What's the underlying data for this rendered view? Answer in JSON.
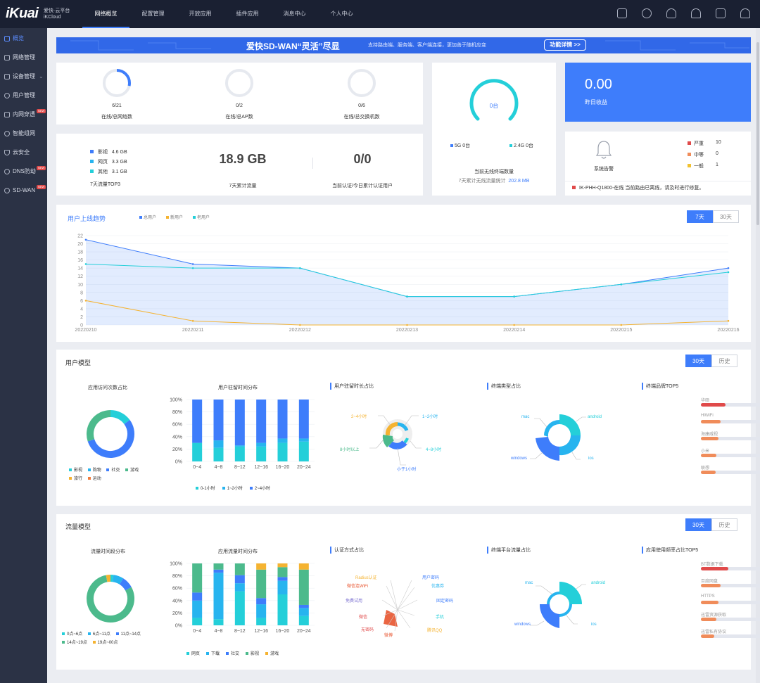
{
  "top": {
    "logo": "iKuai",
    "logo_sub1": "爱快·云平台",
    "logo_sub2": "iKCloud",
    "nav": [
      "网络概览",
      "配置管理",
      "开放应用",
      "插件应用",
      "消息中心",
      "个人中心"
    ]
  },
  "sidebar": {
    "items": [
      {
        "label": "概览",
        "badge": ""
      },
      {
        "label": "网络管理",
        "badge": ""
      },
      {
        "label": "设备管理",
        "badge": ""
      },
      {
        "label": "用户管理",
        "badge": ""
      },
      {
        "label": "内网穿透",
        "badge": "NEW"
      },
      {
        "label": "智能组网",
        "badge": ""
      },
      {
        "label": "云安全",
        "badge": ""
      },
      {
        "label": "DNS防劫",
        "badge": "NEW"
      },
      {
        "label": "SD-WAN",
        "badge": "NEW"
      }
    ]
  },
  "banner": {
    "title": "爱快SD-WAN“灵活”尽显",
    "desc": "支持路由端、服务端、客户端连接，更加善于随机应变",
    "button": "功能详情 >>"
  },
  "stats": {
    "rings": [
      {
        "value": "6/21",
        "label": "在线/总网络数",
        "fraction": 0.2857
      },
      {
        "value": "0/2",
        "label": "在线/总AP数",
        "fraction": 0
      },
      {
        "value": "0/6",
        "label": "在线/总交换机数",
        "fraction": 0
      }
    ],
    "traffic_top3": [
      {
        "name": "影视",
        "value": "4.6 GB",
        "color": "#3e7dfb"
      },
      {
        "name": "网页",
        "value": "3.3 GB",
        "color": "#27b4ef"
      },
      {
        "name": "其他",
        "value": "3.1 GB",
        "color": "#24cfd9"
      }
    ],
    "traffic_top3_label": "7天流量TOP3",
    "total_traffic": "18.9 GB",
    "total_traffic_label": "7天累计流量",
    "auth": "0/0",
    "auth_label": "当前认证/今日累计认证用户"
  },
  "wireless": {
    "center": "0台",
    "g5": "5G  0台",
    "g24": "2.4G  0台",
    "label": "当前无线终端数量",
    "sub_label": "7天累计无线流量统计",
    "sub_value": "202.8 MB"
  },
  "income": {
    "value": "0.00",
    "label": "昨日收益"
  },
  "alarm": {
    "label": "系统告警",
    "levels": [
      {
        "name": "严重",
        "count": "10",
        "color": "#e04a4a"
      },
      {
        "name": "中等",
        "count": "0",
        "color": "#f08c5a"
      },
      {
        "name": "一般",
        "count": "1",
        "color": "#f2c230"
      }
    ],
    "message": "IK-PHH-Q1800-在线  当前路由已离线，请及时进行修复。"
  },
  "trend": {
    "title": "用户上线趋势",
    "legend": [
      {
        "name": "总用户",
        "color": "#3e7dfb"
      },
      {
        "name": "新用户",
        "color": "#f5b331"
      },
      {
        "name": "老用户",
        "color": "#24cfd9"
      }
    ],
    "tabs": [
      "7天",
      "30天"
    ]
  },
  "chart_data": [
    {
      "type": "area",
      "title": "用户上线趋势",
      "x": [
        "20220210",
        "20220211",
        "20220212",
        "20220213",
        "20220214",
        "20220215",
        "20220216"
      ],
      "ylim": [
        0,
        22
      ],
      "yticks": [
        0,
        2,
        4,
        6,
        8,
        10,
        12,
        14,
        16,
        18,
        20,
        22
      ],
      "series": [
        {
          "name": "总用户",
          "values": [
            21,
            15,
            14,
            7,
            7,
            10,
            14
          ],
          "color": "#3e7dfb"
        },
        {
          "name": "新用户",
          "values": [
            6,
            1,
            0,
            0,
            0,
            0,
            1
          ],
          "color": "#f5b331"
        },
        {
          "name": "老用户",
          "values": [
            15,
            14,
            14,
            7,
            7,
            10,
            13
          ],
          "color": "#24cfd9"
        }
      ]
    },
    {
      "type": "bar",
      "title": "用户驻留时间分布",
      "categories": [
        "0~4",
        "4~8",
        "8~12",
        "12~16",
        "16~20",
        "20~24"
      ],
      "ylim": [
        0,
        100
      ],
      "yticks": [
        "0%",
        "20%",
        "40%",
        "60%",
        "80%",
        "100%"
      ],
      "series": [
        {
          "name": "0-1小时",
          "values": [
            30,
            22,
            24,
            24,
            30,
            32
          ],
          "color": "#24cfd9"
        },
        {
          "name": "1~2小时",
          "values": [
            0,
            12,
            2,
            6,
            7,
            5
          ],
          "color": "#27b4ef"
        },
        {
          "name": "2~4小时",
          "values": [
            70,
            66,
            74,
            70,
            63,
            63
          ],
          "color": "#3e7dfb"
        }
      ]
    },
    {
      "type": "bar",
      "title": "应用流量时间分布",
      "categories": [
        "0~4",
        "4~8",
        "8~12",
        "12~16",
        "16~20",
        "20~24"
      ],
      "ylim": [
        0,
        100
      ],
      "yticks": [
        "0%",
        "20%",
        "40%",
        "60%",
        "80%",
        "100%"
      ],
      "series": [
        {
          "name": "网页",
          "values": [
            12,
            10,
            55,
            12,
            50,
            15
          ],
          "color": "#24cfd9"
        },
        {
          "name": "下载",
          "values": [
            28,
            75,
            13,
            22,
            22,
            13
          ],
          "color": "#27b4ef"
        },
        {
          "name": "社交",
          "values": [
            13,
            5,
            13,
            10,
            6,
            5
          ],
          "color": "#3e7dfb"
        },
        {
          "name": "影视",
          "values": [
            47,
            10,
            19,
            46,
            16,
            57
          ],
          "color": "#4cba8c"
        },
        {
          "name": "游戏",
          "values": [
            0,
            0,
            0,
            10,
            6,
            10
          ],
          "color": "#f5b331"
        }
      ]
    },
    {
      "type": "pie",
      "title": "应用访问次数占比",
      "categories": [
        "影视",
        "购物",
        "社交",
        "游戏",
        "旅行",
        "运动"
      ],
      "values": [
        15,
        0,
        55,
        30,
        0,
        0
      ],
      "colors": [
        "#24cfd9",
        "#27b4ef",
        "#3e7dfb",
        "#4cba8c",
        "#f5b331",
        "#f07c3c"
      ]
    },
    {
      "type": "pie",
      "title": "流量时间段分布",
      "categories": [
        "0点~6点",
        "6点~11点",
        "11点~14点",
        "14点~19点",
        "19点~00点"
      ],
      "values": [
        2,
        7,
        8,
        80,
        3
      ],
      "colors": [
        "#24cfd9",
        "#27b4ef",
        "#3e7dfb",
        "#4cba8c",
        "#f5b331"
      ]
    }
  ],
  "user_model": {
    "title": "用户模型",
    "tabs": [
      "30天",
      "历史"
    ],
    "visit_title": "应用访问次数占比",
    "visit_legend": [
      {
        "name": "影视",
        "color": "#24cfd9"
      },
      {
        "name": "购物",
        "color": "#27b4ef"
      },
      {
        "name": "社交",
        "color": "#3e7dfb"
      },
      {
        "name": "游戏",
        "color": "#4cba8c"
      },
      {
        "name": "旅行",
        "color": "#f5b331"
      },
      {
        "name": "运动",
        "color": "#f07c3c"
      }
    ],
    "stay_title": "用户驻留时间分布",
    "stay_legend": [
      {
        "name": "0-1小时",
        "color": "#24cfd9"
      },
      {
        "name": "1~2小时",
        "color": "#27b4ef"
      },
      {
        "name": "2~4小时",
        "color": "#3e7dfb"
      }
    ],
    "stay_share_title": "用户驻留时长占比",
    "stay_share_labels": [
      {
        "text": "2~4小时",
        "color": "#f5b331"
      },
      {
        "text": "1~2小时",
        "color": "#27b4ef"
      },
      {
        "text": "8小时以上",
        "color": "#4cba8c"
      },
      {
        "text": "4~8小时",
        "color": "#24cfd9"
      },
      {
        "text": "小于1小时",
        "color": "#3e7dfb"
      }
    ],
    "device_title": "终端类型占比",
    "device_labels": [
      {
        "text": "mac",
        "color": "#27b4ef"
      },
      {
        "text": "android",
        "color": "#24cfd9"
      },
      {
        "text": "windows",
        "color": "#3e7dfb"
      },
      {
        "text": "ios",
        "color": "#27b4ef"
      }
    ],
    "brand_title": "终端品牌TOP5",
    "brands": [
      {
        "name": "华硕",
        "fill": 0.25,
        "color": "#e04a4a"
      },
      {
        "name": "HiWiFi",
        "fill": 0.2,
        "color": "#f08c5a"
      },
      {
        "name": "海康威视",
        "fill": 0.18,
        "color": "#f08c5a"
      },
      {
        "name": "小米",
        "fill": 0.16,
        "color": "#f08c5a"
      },
      {
        "name": "联想",
        "fill": 0.15,
        "color": "#f08c5a"
      }
    ]
  },
  "traffic_model": {
    "title": "流量模型",
    "tabs": [
      "30天",
      "历史"
    ],
    "period_title": "流量时间段分布",
    "period_legend": [
      {
        "name": "0点~6点",
        "color": "#24cfd9"
      },
      {
        "name": "6点~11点",
        "color": "#27b4ef"
      },
      {
        "name": "11点~14点",
        "color": "#3e7dfb"
      },
      {
        "name": "14点~19点",
        "color": "#4cba8c"
      },
      {
        "name": "19点~00点",
        "color": "#f5b331"
      }
    ],
    "app_title": "应用流量时间分布",
    "app_legend": [
      {
        "name": "网页",
        "color": "#24cfd9"
      },
      {
        "name": "下载",
        "color": "#27b4ef"
      },
      {
        "name": "社交",
        "color": "#3e7dfb"
      },
      {
        "name": "影视",
        "color": "#4cba8c"
      },
      {
        "name": "游戏",
        "color": "#f5b331"
      }
    ],
    "auth_title": "认证方式占比",
    "auth_labels": [
      {
        "text": "Radius认证",
        "color": "#f5b331"
      },
      {
        "text": "用户密码",
        "color": "#3e7dfb"
      },
      {
        "text": "微信连WiFi",
        "color": "#e8542e"
      },
      {
        "text": "优惠券",
        "color": "#27b4ef"
      },
      {
        "text": "免费试用",
        "color": "#7a6fd1"
      },
      {
        "text": "固定密码",
        "color": "#3e7dfb"
      },
      {
        "text": "微信",
        "color": "#e04a4a"
      },
      {
        "text": "手机",
        "color": "#24cfd9"
      },
      {
        "text": "无密码",
        "color": "#e04a4a"
      },
      {
        "text": "微博",
        "color": "#e8542e"
      },
      {
        "text": "腾讯QQ",
        "color": "#f5b331"
      }
    ],
    "platform_title": "终端平台流量占比",
    "platform_labels": [
      {
        "text": "mac",
        "color": "#27b4ef"
      },
      {
        "text": "android",
        "color": "#24cfd9"
      },
      {
        "text": "windows",
        "color": "#3e7dfb"
      },
      {
        "text": "ios",
        "color": "#27b4ef"
      }
    ],
    "appfreq_title": "应用使用频率占比TOP5",
    "appfreq": [
      {
        "name": "BT数据下载",
        "fill": 0.28,
        "color": "#e04a4a"
      },
      {
        "name": "百度网盘",
        "fill": 0.2,
        "color": "#f08c5a"
      },
      {
        "name": "HTTPS",
        "fill": 0.18,
        "color": "#f08c5a"
      },
      {
        "name": "迅雷资源获取",
        "fill": 0.16,
        "color": "#f08c5a"
      },
      {
        "name": "迅雷私有协议",
        "fill": 0.14,
        "color": "#f08c5a"
      }
    ]
  }
}
